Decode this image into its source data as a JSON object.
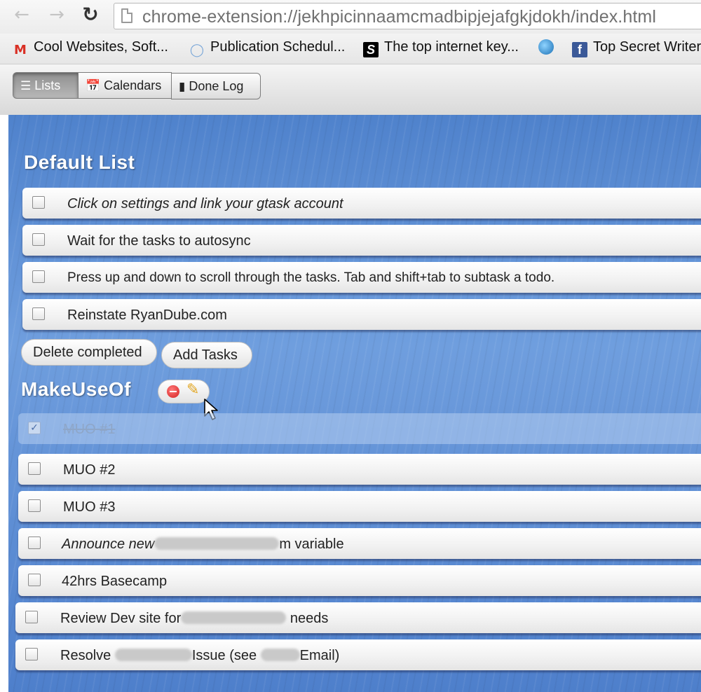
{
  "browser": {
    "url": "chrome-extension://jekhpicinnaamcmadbipjejafgkjdokh/index.html",
    "bookmarks": [
      {
        "label": "Cool Websites, Soft...",
        "icon": "gmail-icon"
      },
      {
        "label": "Publication Schedul...",
        "icon": "lightbulb-icon"
      },
      {
        "label": "The top internet key...",
        "icon": "s-logo-icon"
      },
      {
        "label": "",
        "icon": "globe-icon"
      },
      {
        "label": "Top Secret Writer",
        "icon": "facebook-icon"
      }
    ]
  },
  "toolbar": {
    "tabs": [
      {
        "label": "Lists",
        "icon": "list-icon",
        "active": true
      },
      {
        "label": "Calendars",
        "icon": "calendar-icon",
        "active": false
      },
      {
        "label": "Done Log",
        "icon": "book-icon",
        "active": false
      }
    ]
  },
  "lists": [
    {
      "title": "Default List",
      "tasks": [
        {
          "text": "Click on settings and link your gtask account",
          "done": false,
          "italic": true
        },
        {
          "text": "Wait for the tasks to autosync",
          "done": false
        },
        {
          "text": "Press up and down to scroll through the tasks. Tab and shift+tab to subtask a todo.",
          "done": false
        },
        {
          "text": "Reinstate RyanDube.com",
          "done": false
        }
      ],
      "buttons": {
        "delete_completed": "Delete completed",
        "add_tasks": "Add Tasks"
      }
    },
    {
      "title": "MakeUseOf",
      "tasks": [
        {
          "text": "MUO #1",
          "done": true
        },
        {
          "text": "MUO #2",
          "done": false
        },
        {
          "text": "MUO #3",
          "done": false
        },
        {
          "text_before": "Announce new",
          "text_after": "m variable",
          "done": false,
          "italic": true,
          "redacted": true
        },
        {
          "text": "42hrs Basecamp",
          "done": false
        },
        {
          "text_before": "Review Dev site for",
          "text_after": "needs",
          "done": false,
          "redacted": true
        },
        {
          "text_before": "Resolve",
          "text_middle": "Issue (see",
          "text_after": "Email)",
          "done": false,
          "redacted": true
        }
      ]
    }
  ],
  "colors": {
    "panel_blue": "#5b8cd6",
    "delete_red": "#d42020",
    "edit_pencil": "#e2a623",
    "done_text": "#8ea6c8"
  }
}
